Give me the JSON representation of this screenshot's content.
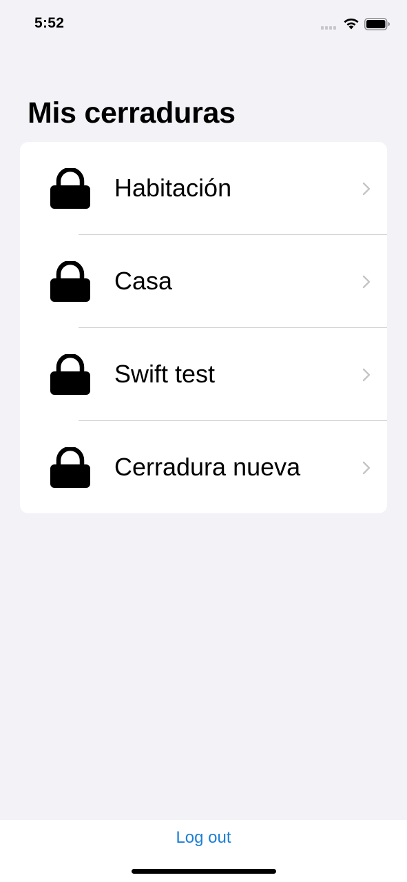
{
  "status_bar": {
    "time": "5:52"
  },
  "title": "Mis cerraduras",
  "locks": [
    {
      "name": "Habitación",
      "icon": "lock-icon"
    },
    {
      "name": "Casa",
      "icon": "lock-icon"
    },
    {
      "name": "Swift test",
      "icon": "lock-icon"
    },
    {
      "name": "Cerradura nueva",
      "icon": "lock-icon"
    }
  ],
  "footer": {
    "logout_label": "Log out"
  },
  "colors": {
    "background": "#f2f2f7",
    "card": "#ffffff",
    "accent": "#1c7ed6",
    "chevron": "#c4c4c7",
    "separator": "#d1d1d6"
  }
}
